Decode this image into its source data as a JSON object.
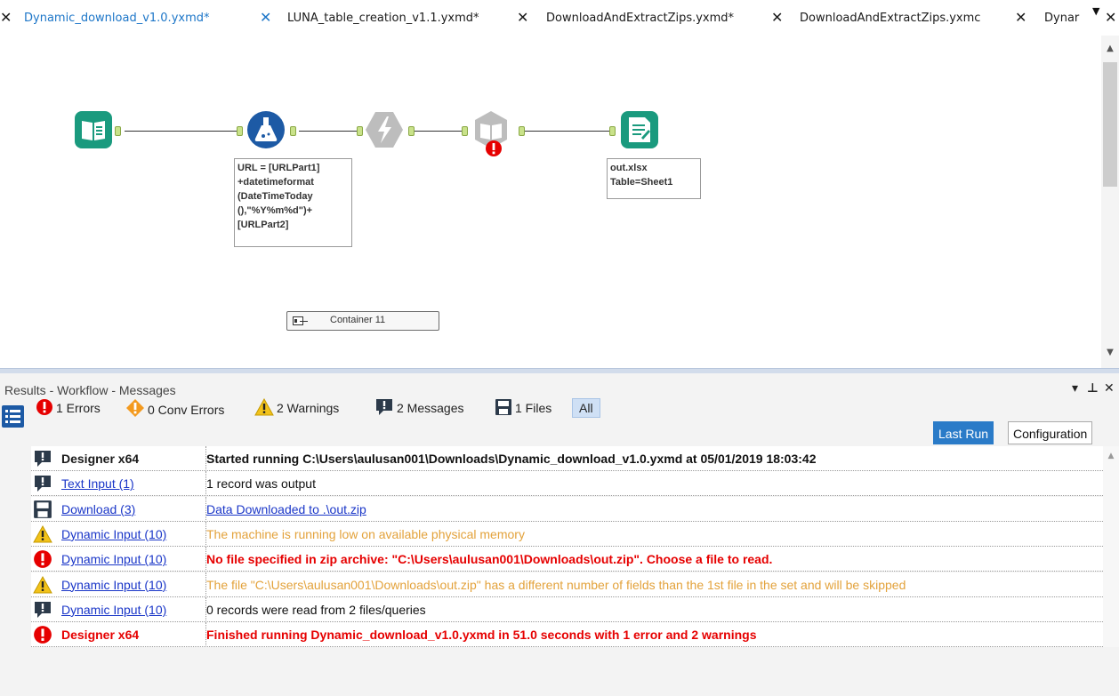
{
  "tabs": [
    {
      "label": "Dynamic_download_v1.0.yxmd*",
      "active": true
    },
    {
      "label": "LUNA_table_creation_v1.1.yxmd*",
      "active": false
    },
    {
      "label": "DownloadAndExtractZips.yxmd*",
      "active": false
    },
    {
      "label": "DownloadAndExtractZips.yxmc",
      "active": false
    },
    {
      "label": "Dynar",
      "active": false
    }
  ],
  "canvas": {
    "tools": [
      {
        "name": "input-data-tool",
        "icon": "book-icon",
        "color": "#1a9a7e"
      },
      {
        "name": "formula-tool",
        "icon": "flask-icon",
        "color": "#1d5aa5"
      },
      {
        "name": "download-tool",
        "icon": "lightning-icon",
        "color": "#b8b8b8"
      },
      {
        "name": "dynamic-input-tool",
        "icon": "open-book-icon",
        "color": "#b8b8b8"
      },
      {
        "name": "output-data-tool",
        "icon": "document-icon",
        "color": "#1a9a7e"
      }
    ],
    "formula_annotation": "URL = [URLPart1]\n+datetimeformat\n(DateTimeToday\n(),\"%Y%m%d\")+\n[URLPart2]",
    "output_annotation": "out.xlsx\nTable=Sheet1",
    "container_label": "Container 11"
  },
  "panel": {
    "title": "Results - Workflow - Messages",
    "filters": {
      "errors": "1 Errors",
      "conv_errors": "0 Conv Errors",
      "warnings": "2 Warnings",
      "messages": "2 Messages",
      "files": "1 Files",
      "all": "All"
    },
    "last_run": "Last Run",
    "configuration": "Configuration"
  },
  "messages": [
    {
      "type": "message",
      "source": "Designer x64",
      "source_link": false,
      "text": "Started running C:\\Users\\aulusan001\\Downloads\\Dynamic_download_v1.0.yxmd at 05/01/2019 18:03:42",
      "style": "bold"
    },
    {
      "type": "message",
      "source": "Text Input (1)",
      "source_link": true,
      "text": "1 record was output",
      "style": "normal"
    },
    {
      "type": "file",
      "source": "Download (3)",
      "source_link": true,
      "text": "Data Downloaded to .\\out.zip",
      "style": "link"
    },
    {
      "type": "warning",
      "source": "Dynamic Input (10)",
      "source_link": true,
      "text": "The machine is running low on available physical memory",
      "style": "warn"
    },
    {
      "type": "error",
      "source": "Dynamic Input (10)",
      "source_link": true,
      "text": "No file specified in zip archive: \"C:\\Users\\aulusan001\\Downloads\\out.zip\". Choose a file to read.",
      "style": "err"
    },
    {
      "type": "warning",
      "source": "Dynamic Input (10)",
      "source_link": true,
      "text": "The file \"C:\\Users\\aulusan001\\Downloads\\out.zip\" has a different number of fields than the 1st file in the set and will be skipped",
      "style": "warn"
    },
    {
      "type": "message",
      "source": "Dynamic Input (10)",
      "source_link": true,
      "text": "0 records were read from 2 files/queries",
      "style": "normal"
    },
    {
      "type": "error",
      "source": "Designer x64",
      "source_link": false,
      "text": "Finished running Dynamic_download_v1.0.yxmd in 51.0 seconds with 1 error and 2 warnings",
      "style": "err"
    }
  ],
  "colors": {
    "accent": "#1d76c8",
    "error": "#e60000",
    "warning": "#e3a23b",
    "link": "#1a36c8",
    "tool_green": "#1a9a7e",
    "tool_blue": "#1d5aa5"
  }
}
